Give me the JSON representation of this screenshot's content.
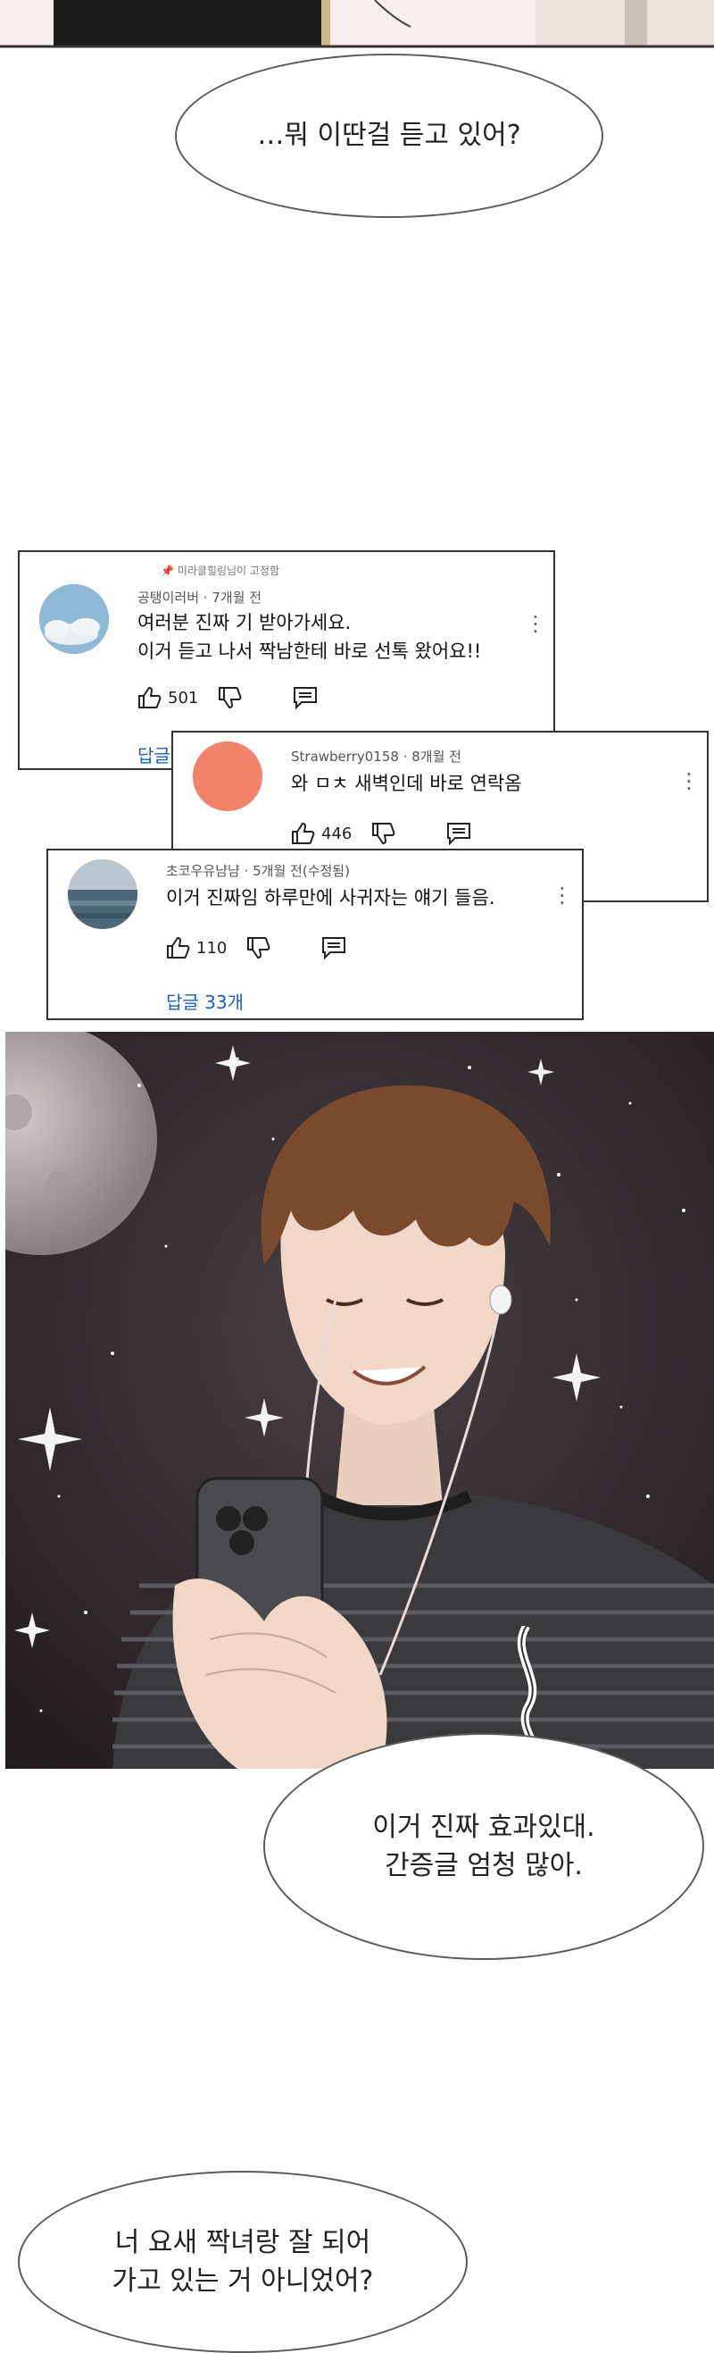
{
  "bubbles": {
    "top": "…뭐 이딴걸 듣고 있어?",
    "middle": "이거 진짜 효과있대.\n간증글 엄청 많아.",
    "bottom": "너 요새 짝녀랑 잘 되어\n가고 있는 거 아니었어?"
  },
  "comments": [
    {
      "pinned": "미라클힐링님이 고정함",
      "author": "공탱이러버",
      "time": "7개월 전",
      "text": "여러분 진짜 기 받아가세요.\n이거 듣고 나서 짝남한테 바로 선톡 왔어요!!",
      "likes": "501",
      "reply": "답글"
    },
    {
      "author": "Strawberry0158",
      "time": "8개월 전",
      "text": "와 ㅁㅊ 새벽인데 바로 연락옴",
      "likes": "446"
    },
    {
      "author": "초코우유냠냠",
      "time": "5개월 전(수정됨)",
      "text": "이거 진짜임 하루만에 사귀자는 얘기 들음.",
      "likes": "110",
      "reply": "답글 33개"
    }
  ],
  "colors": {
    "avatar_sky": "#8fb8d6",
    "avatar_peach": "#f2836b",
    "avatar_sea": "#6f8796",
    "reply_blue": "#1a5fb4",
    "night_sky": "#2a2326"
  },
  "icons": [
    "thumb-up-icon",
    "thumb-down-icon",
    "comment-icon",
    "more-vert-icon",
    "pin-icon"
  ]
}
